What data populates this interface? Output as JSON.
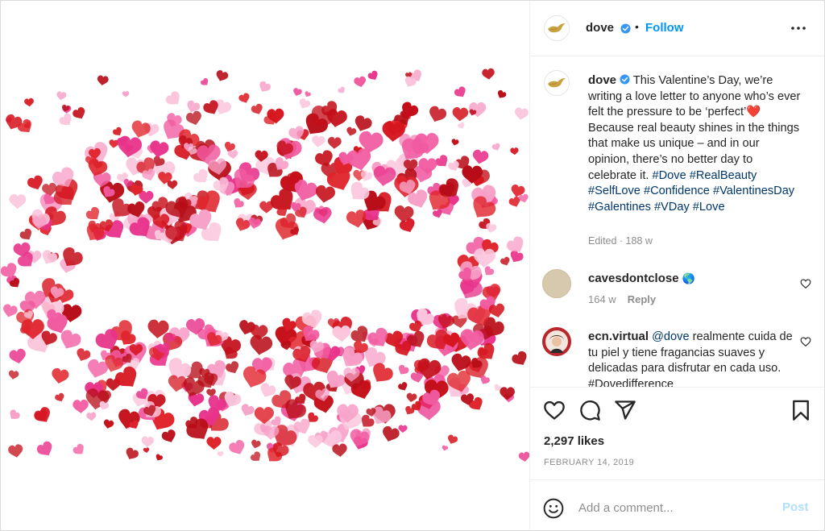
{
  "post": {
    "account": "dove",
    "follow_label": "Follow",
    "dot": "•",
    "caption_text": "This Valentine’s Day, we’re writing a love letter to anyone who’s ever felt the pressure to be ‘perfect’❤️Because real beauty shines in the things that make us unique – and in our opinion, there’s no better day to celebrate it.",
    "hashtags": "#Dove #RealBeauty #SelfLove #Confidence #ValentinesDay #Galentines #VDay #Love",
    "edited": "Edited · 188 w"
  },
  "comments": [
    {
      "user": "cavesdontclose",
      "emoji": "🌎",
      "age": "164 w",
      "reply_label": "Reply"
    },
    {
      "user": "ecn.virtual",
      "mention": "@dove",
      "text": "realmente cuida de tu piel y tiene fragancias suaves y delicadas para disfrutar en cada uso. #Dovedifference"
    }
  ],
  "stats": {
    "likes": "2,297 likes",
    "date": "FEBRUARY 14, 2019"
  },
  "composer": {
    "placeholder": "Add a comment...",
    "post_label": "Post"
  },
  "icons": [
    "dove-logo-icon",
    "verified-badge-icon",
    "more-options-icon",
    "like-icon",
    "comment-icon",
    "share-icon",
    "save-icon",
    "emoji-icon",
    "heart-small-icon"
  ],
  "colors": {
    "accent": "#0095f6",
    "verified": "#3897f0",
    "hashtag": "#00376b",
    "muted": "#8e8e8e",
    "post_disabled": "#b2dffc"
  }
}
